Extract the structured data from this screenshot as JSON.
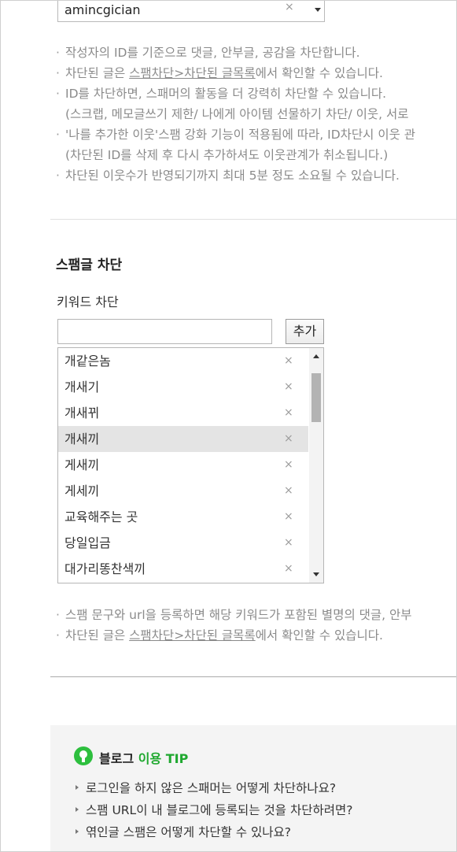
{
  "id_block": {
    "selected_id": "amincgician",
    "notes": [
      {
        "bullet": true,
        "text": "작성자의 ID를 기준으로 댓글, 안부글, 공감을 차단합니다."
      },
      {
        "bullet": true,
        "pre": "차단된 글은 ",
        "link": "스팸차단>차단된 글목록",
        "post": "에서 확인할 수 있습니다."
      },
      {
        "bullet": true,
        "text": "ID를 차단하면, 스패머의 활동을 더 강력히 차단할 수 있습니다."
      },
      {
        "bullet": false,
        "text": "(스크랩, 메모글쓰기 제한/ 나에게 아이템 선물하기 차단/ 이웃, 서로"
      },
      {
        "bullet": true,
        "text": "'나를 추가한 이웃'스팸 강화 기능이 적용됨에 따라, ID차단시 이웃 관"
      },
      {
        "bullet": false,
        "text": "(차단된 ID를 삭제 후 다시 추가하셔도 이웃관계가 취소됩니다.)"
      },
      {
        "bullet": true,
        "text": "차단된 이웃수가 반영되기까지 최대 5분 정도 소요될 수 있습니다."
      }
    ]
  },
  "spam_block": {
    "title": "스팸글 차단",
    "keyword_label": "키워드 차단",
    "keyword_input_value": "",
    "add_button": "추가",
    "delete_glyph": "×",
    "selected_index": 3,
    "keywords": [
      "개같은놈",
      "개새기",
      "개새뀌",
      "개새끼",
      "게새끼",
      "게세끼",
      "교육해주는 곳",
      "당일입금",
      "대가리똥찬색끼"
    ],
    "notes": [
      {
        "bullet": true,
        "text": "스팸 문구와 url을 등록하면 해당 키워드가 포함된 별명의 댓글, 안부"
      },
      {
        "bullet": true,
        "pre": "차단된 글은 ",
        "link": "스팸차단>차단된 글목록",
        "post": "에서 확인할 수 있습니다."
      }
    ]
  },
  "tip": {
    "title_part1": "블로그",
    "title_part2": " 이용 TIP",
    "items": [
      "로그인을 하지 않은 스패머는 어떻게 차단하나요?",
      "스팸 URL이 내 블로그에 등록되는 것을 차단하려면?",
      "엮인글 스팸은 어떻게 차단할 수 있나요?"
    ]
  },
  "colors": {
    "tip_green": "#2dbf3e",
    "selected_row": "#e4e4e4",
    "note_gray": "#8a8a8a"
  }
}
